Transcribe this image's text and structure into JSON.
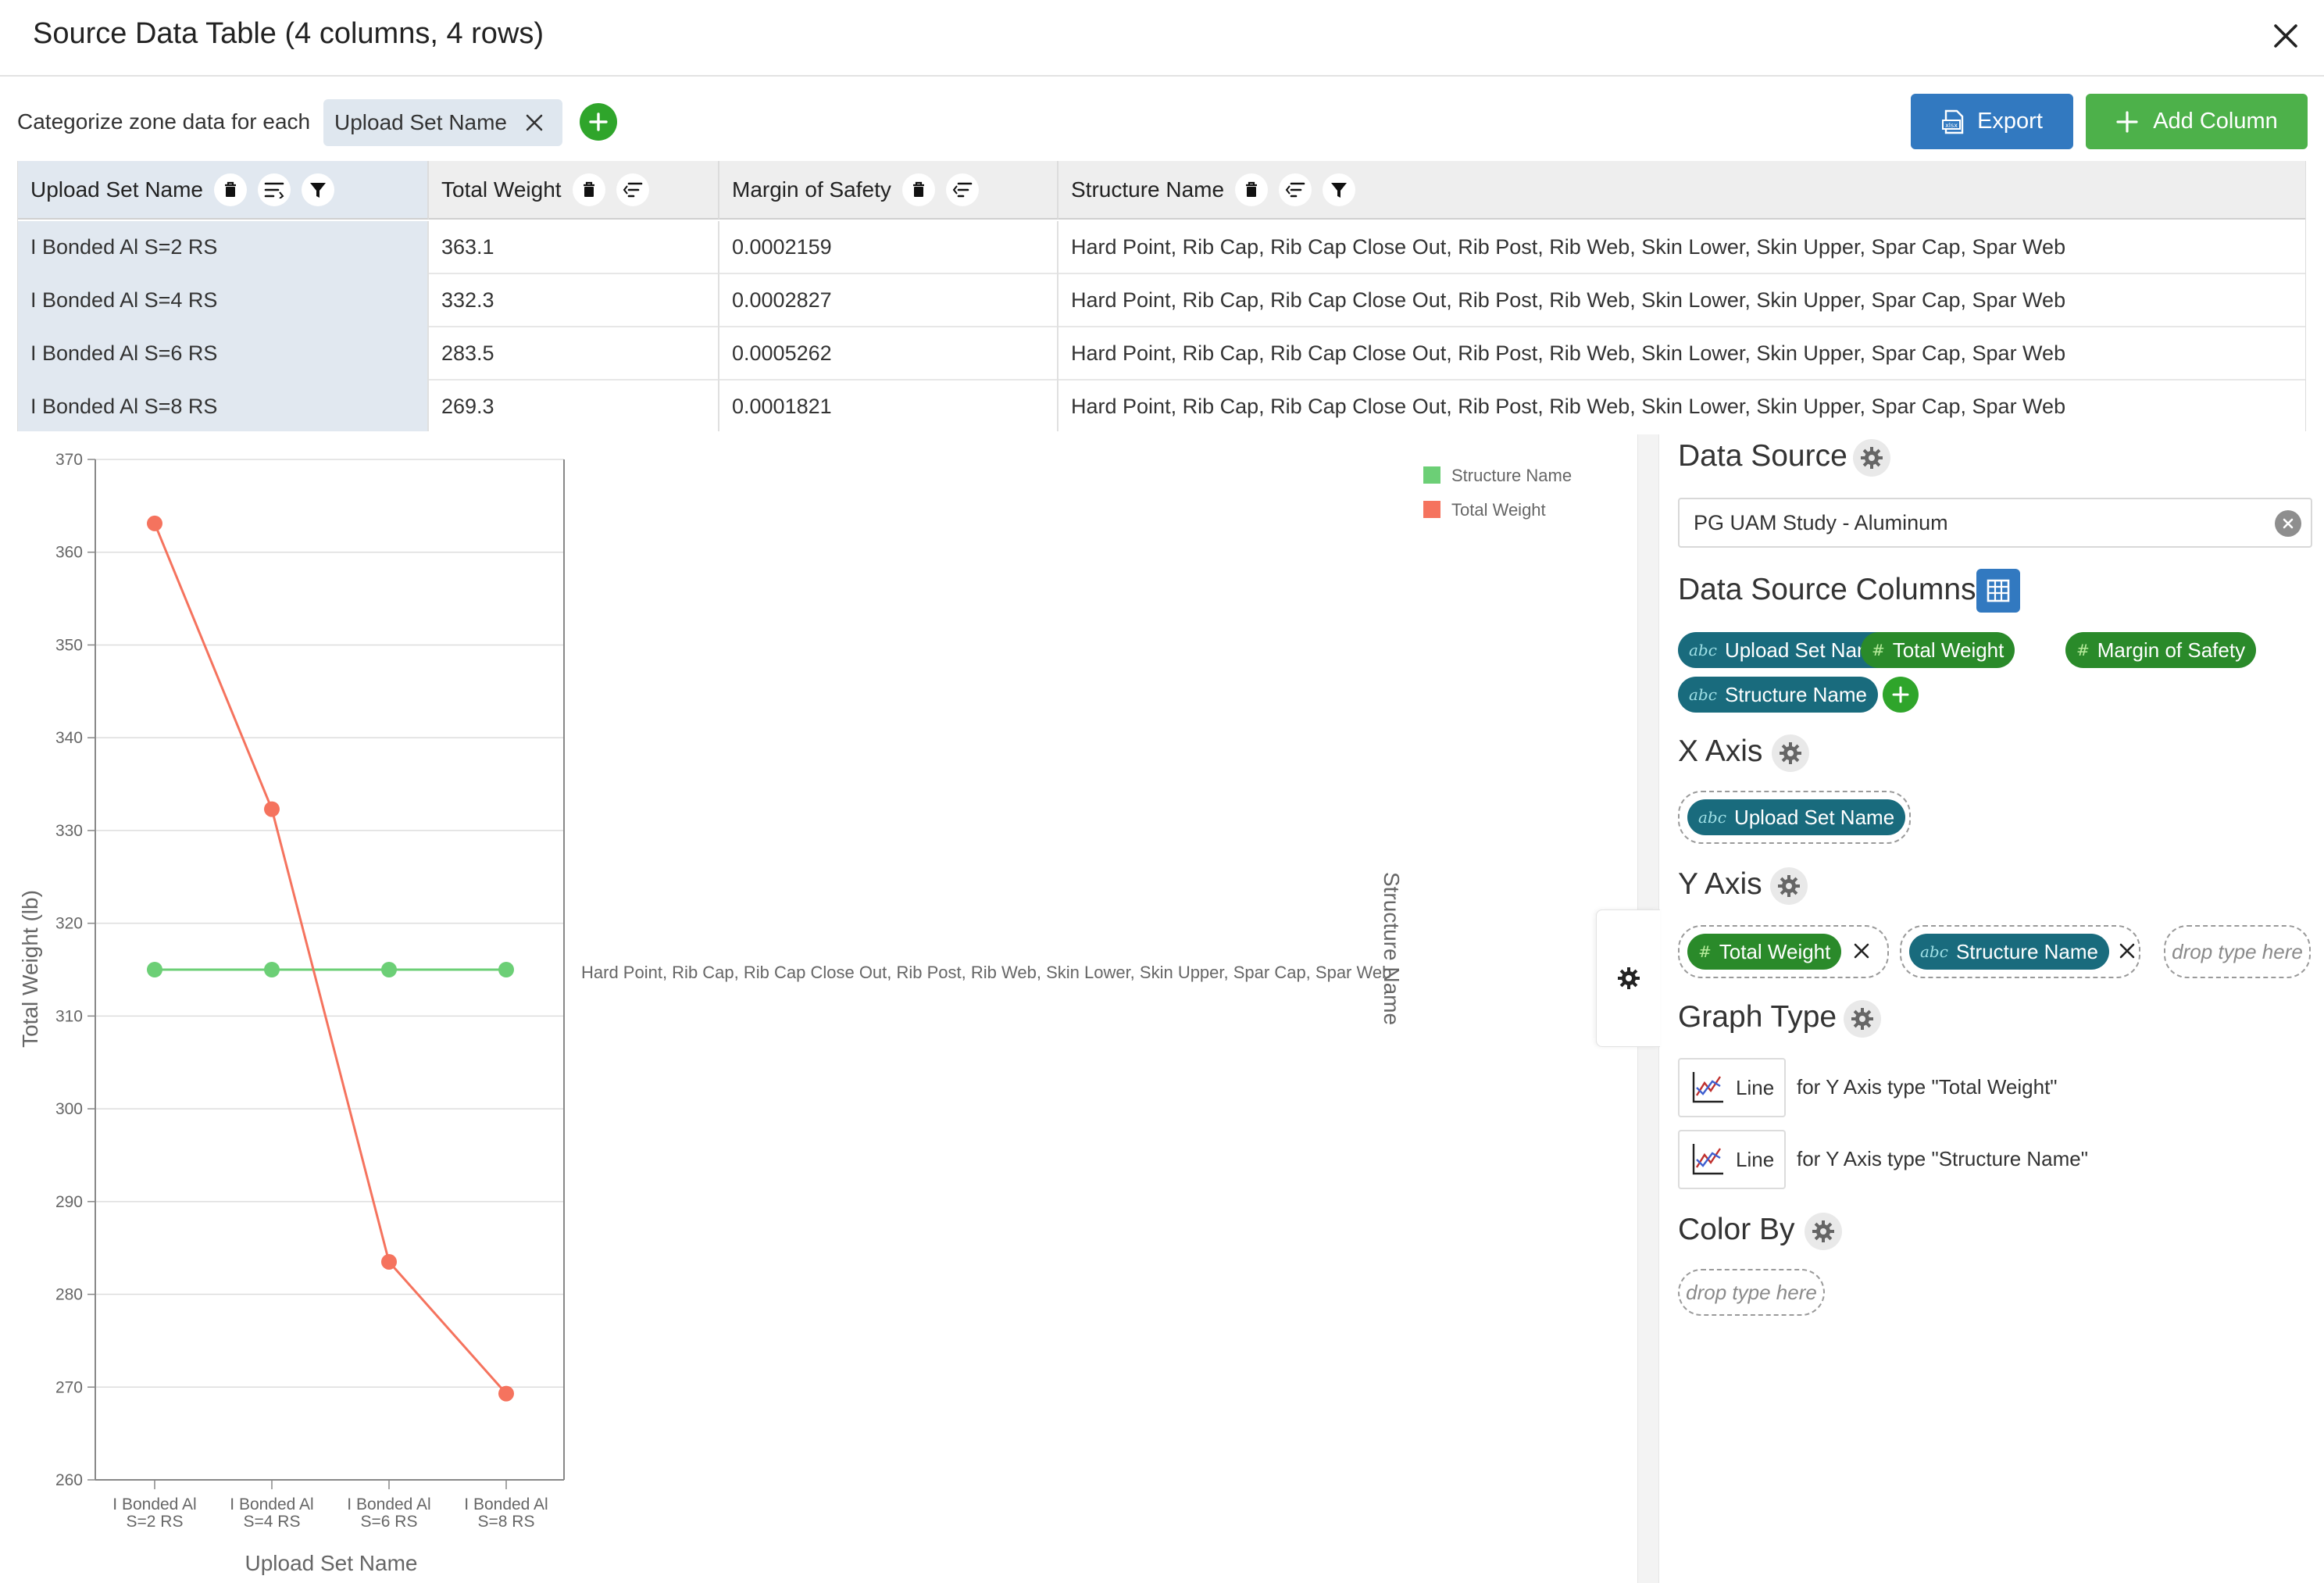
{
  "dialog": {
    "title": "Source Data Table (4 columns, 4 rows)"
  },
  "toolbar": {
    "categorize_label": "Categorize zone data for each",
    "categorize_chip": "Upload Set Name",
    "export_label": "Export",
    "add_column_label": "Add Column"
  },
  "table": {
    "columns": [
      "Upload Set Name",
      "Total Weight",
      "Margin of Safety",
      "Structure Name"
    ],
    "rows": [
      [
        "I Bonded Al S=2 RS",
        "363.1",
        "0.0002159",
        "Hard Point, Rib Cap, Rib Cap Close Out, Rib Post, Rib Web, Skin Lower, Skin Upper, Spar Cap, Spar Web"
      ],
      [
        "I Bonded Al S=4 RS",
        "332.3",
        "0.0002827",
        "Hard Point, Rib Cap, Rib Cap Close Out, Rib Post, Rib Web, Skin Lower, Skin Upper, Spar Cap, Spar Web"
      ],
      [
        "I Bonded Al S=6 RS",
        "283.5",
        "0.0005262",
        "Hard Point, Rib Cap, Rib Cap Close Out, Rib Post, Rib Web, Skin Lower, Skin Upper, Spar Cap, Spar Web"
      ],
      [
        "I Bonded Al S=8 RS",
        "269.3",
        "0.0001821",
        "Hard Point, Rib Cap, Rib Cap Close Out, Rib Post, Rib Web, Skin Lower, Skin Upper, Spar Cap, Spar Web"
      ]
    ]
  },
  "chart_data": {
    "type": "line",
    "xlabel": "Upload Set Name",
    "ylabel": "Total Weight (lb)",
    "y2label": "Structure Name",
    "categories": [
      [
        "I Bonded Al",
        "S=2 RS"
      ],
      [
        "I Bonded Al",
        "S=4 RS"
      ],
      [
        "I Bonded Al",
        "S=6 RS"
      ],
      [
        "I Bonded Al",
        "S=8 RS"
      ]
    ],
    "ylim": [
      260,
      370
    ],
    "yticks": [
      260,
      270,
      280,
      290,
      300,
      310,
      320,
      330,
      340,
      350,
      360,
      370
    ],
    "y2_category": "Hard Point, Rib Cap, Rib Cap Close Out, Rib Post, Rib Web, Skin Lower, Skin Upper, Spar Cap, Spar Web",
    "grid": true,
    "legend_position": "top-right",
    "series": [
      {
        "name": "Structure Name",
        "axis": "y2",
        "color": "#6ccf76",
        "values": [
          "Hard Point, Rib Cap, Rib Cap Close Out, Rib Post, Rib Web, Skin Lower, Skin Upper, Spar Cap, Spar Web",
          "Hard Point, Rib Cap, Rib Cap Close Out, Rib Post, Rib Web, Skin Lower, Skin Upper, Spar Cap, Spar Web",
          "Hard Point, Rib Cap, Rib Cap Close Out, Rib Post, Rib Web, Skin Lower, Skin Upper, Spar Cap, Spar Web",
          "Hard Point, Rib Cap, Rib Cap Close Out, Rib Post, Rib Web, Skin Lower, Skin Upper, Spar Cap, Spar Web"
        ]
      },
      {
        "name": "Total Weight",
        "axis": "y",
        "color": "#f5735e",
        "values": [
          363.1,
          332.3,
          283.5,
          269.3
        ]
      }
    ]
  },
  "panel": {
    "data_source_title": "Data Source",
    "data_source_value": "PG UAM Study - Aluminum",
    "columns_title": "Data Source Columns",
    "columns": [
      {
        "label": "Upload Set Name",
        "type": "abc"
      },
      {
        "label": "Total Weight",
        "type": "#"
      },
      {
        "label": "Margin of Safety",
        "type": "#"
      },
      {
        "label": "Structure Name",
        "type": "abc"
      }
    ],
    "x_axis_title": "X Axis",
    "x_axis_item": {
      "label": "Upload Set Name",
      "type": "abc"
    },
    "y_axis_title": "Y Axis",
    "y_axis_items": [
      {
        "label": "Total Weight",
        "type": "#"
      },
      {
        "label": "Structure Name",
        "type": "abc"
      }
    ],
    "drop_placeholder": "drop type here",
    "graph_type_title": "Graph Type",
    "graph_types": [
      {
        "button": "Line",
        "desc": "for Y Axis type \"Total Weight\""
      },
      {
        "button": "Line",
        "desc": "for Y Axis type \"Structure Name\""
      }
    ],
    "color_by_title": "Color By",
    "color_by_placeholder": "drop type here"
  },
  "colors": {
    "primary_blue": "#3279c0",
    "green_button": "#4db14a",
    "abc_pill": "#196b7d",
    "num_pill": "#2a8a2a",
    "series_total_weight": "#f5735e",
    "series_structure_name": "#6ccf76"
  },
  "icons": {
    "close": "close-icon",
    "delete": "trash-icon",
    "sort": "sort-icon",
    "filter": "filter-icon",
    "export": "xlsx-file-icon",
    "add": "plus-icon",
    "settings": "gear-icon",
    "grid": "table-grid-icon",
    "line_chart": "line-chart-icon"
  }
}
